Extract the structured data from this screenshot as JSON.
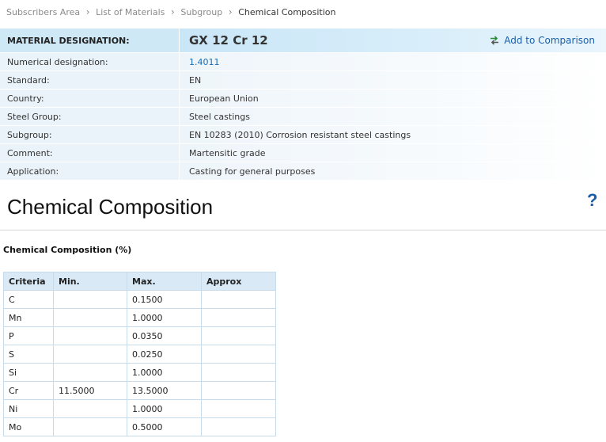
{
  "breadcrumb": {
    "items": [
      "Subscribers Area",
      "List of Materials",
      "Subgroup"
    ],
    "current": "Chemical Composition"
  },
  "material": {
    "header_label": "MATERIAL DESIGNATION:",
    "designation": "GX 12 Cr 12",
    "compare_label": "Add to Comparison",
    "rows": [
      {
        "label": "Numerical designation:",
        "value": "1.4011"
      },
      {
        "label": "Standard:",
        "value": "EN"
      },
      {
        "label": "Country:",
        "value": "European Union"
      },
      {
        "label": "Steel Group:",
        "value": "Steel castings"
      },
      {
        "label": "Subgroup:",
        "value": "EN 10283 (2010) Corrosion resistant steel castings"
      },
      {
        "label": "Comment:",
        "value": "Martensitic grade"
      },
      {
        "label": "Application:",
        "value": "Casting for general purposes"
      }
    ]
  },
  "section": {
    "title": "Chemical Composition",
    "help": "?",
    "subtitle": "Chemical Composition (%)"
  },
  "composition": {
    "headers": [
      "Criteria",
      "Min.",
      "Max.",
      "Approx"
    ],
    "rows": [
      [
        "C",
        "",
        "0.1500",
        ""
      ],
      [
        "Mn",
        "",
        "1.0000",
        ""
      ],
      [
        "P",
        "",
        "0.0350",
        ""
      ],
      [
        "S",
        "",
        "0.0250",
        ""
      ],
      [
        "Si",
        "",
        "1.0000",
        ""
      ],
      [
        "Cr",
        "11.5000",
        "13.5000",
        ""
      ],
      [
        "Ni",
        "",
        "1.0000",
        ""
      ],
      [
        "Mo",
        "",
        "0.5000",
        ""
      ]
    ]
  },
  "colors": {
    "link": "#1a6ab0",
    "header_bg": "#cfe8f6",
    "label_bg": "#e9f3f9"
  }
}
